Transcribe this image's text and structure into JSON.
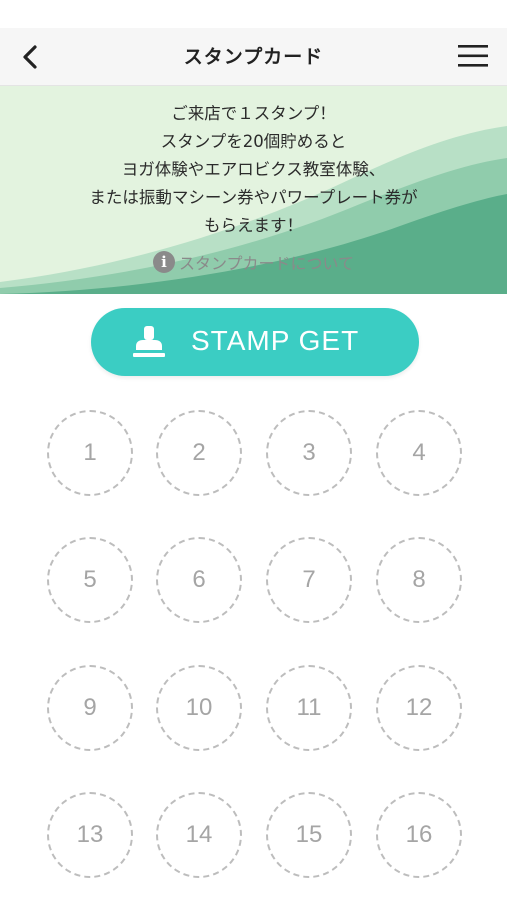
{
  "header": {
    "title": "スタンプカード",
    "back_icon": "chevron-left-icon",
    "menu_icon": "hamburger-menu-icon"
  },
  "banner": {
    "lines": [
      "ご来店で１スタンプ！",
      "スタンプを20個貯めると",
      "ヨガ体験やエアロビクス教室体験、",
      "または振動マシーン券やパワープレート券が",
      "もらえます！"
    ],
    "info_icon": "info-icon",
    "info_link": "スタンプカードについて"
  },
  "stamp_button": {
    "icon": "stamp-icon",
    "label": "STAMP GET"
  },
  "slots": [
    "1",
    "2",
    "3",
    "4",
    "5",
    "6",
    "7",
    "8",
    "9",
    "10",
    "11",
    "12",
    "13",
    "14",
    "15",
    "16"
  ],
  "colors": {
    "accent": "#3bcdc3",
    "banner_bg": "#e3f3df",
    "wave_dark": "#5aae8a",
    "wave_light": "#8ccaa8",
    "slot_border": "#bdbdbd",
    "slot_text": "#a5a5a5"
  }
}
